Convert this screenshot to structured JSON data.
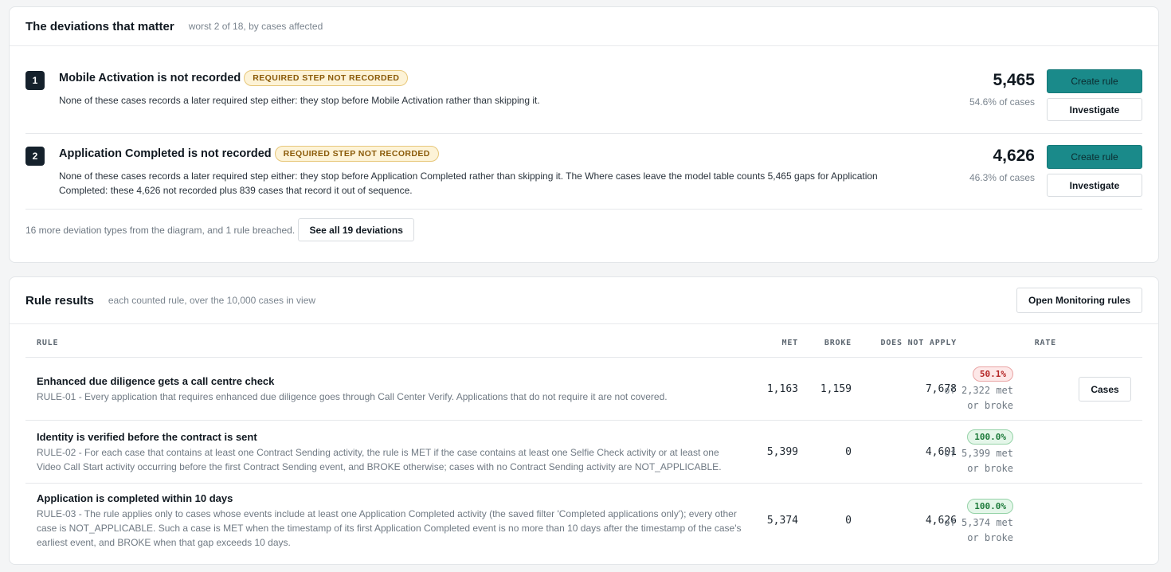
{
  "deviations": {
    "title": "The deviations that matter",
    "subtitle": "worst 2 of 18, by cases affected",
    "items": [
      {
        "rank": "1",
        "title": "Mobile Activation is not recorded",
        "badge": "REQUIRED STEP NOT RECORDED",
        "description": "None of these cases records a later required step either: they stop before Mobile Activation rather than skipping it.",
        "count": "5,465",
        "pct": "54.6% of cases",
        "create_label": "Create rule",
        "investigate_label": "Investigate"
      },
      {
        "rank": "2",
        "title": "Application Completed is not recorded",
        "badge": "REQUIRED STEP NOT RECORDED",
        "description": "None of these cases records a later required step either: they stop before Application Completed rather than skipping it. The Where cases leave the model table counts 5,465 gaps for Application Completed: these 4,626 not recorded plus 839 cases that record it out of sequence.",
        "count": "4,626",
        "pct": "46.3% of cases",
        "create_label": "Create rule",
        "investigate_label": "Investigate"
      }
    ],
    "footer_text": "16 more deviation types from the diagram, and 1 rule breached.",
    "see_all_label": "See all 19 deviations"
  },
  "rules": {
    "title": "Rule results",
    "subtitle": "each counted rule, over the 10,000 cases in view",
    "open_label": "Open Monitoring rules",
    "columns": {
      "rule": "RULE",
      "met": "MET",
      "broke": "BROKE",
      "dna": "DOES NOT APPLY",
      "rate": "RATE"
    },
    "rows": [
      {
        "name": "Enhanced due diligence gets a call centre check",
        "description": "RULE-01 - Every application that requires enhanced due diligence goes through Call Center Verify. Applications that do not require it are not covered.",
        "met": "1,163",
        "broke": "1,159",
        "dna": "7,678",
        "rate": "50.1%",
        "rate_note": "of 2,322 met or broke",
        "cases_label": "Cases"
      },
      {
        "name": "Identity is verified before the contract is sent",
        "description": "RULE-02 - For each case that contains at least one Contract Sending activity, the rule is MET if the case contains at least one Selfie Check activity or at least one Video Call Start activity occurring before the first Contract Sending event, and BROKE otherwise; cases with no Contract Sending activity are NOT_APPLICABLE.",
        "met": "5,399",
        "broke": "0",
        "dna": "4,601",
        "rate": "100.0%",
        "rate_note": "of 5,399 met or broke"
      },
      {
        "name": "Application is completed within 10 days",
        "description": "RULE-03 - The rule applies only to cases whose events include at least one Application Completed activity (the saved filter 'Completed applications only'); every other case is NOT_APPLICABLE. Such a case is MET when the timestamp of its first Application Completed event is no more than 10 days after the timestamp of the case's earliest event, and BROKE when that gap exceeds 10 days.",
        "met": "5,374",
        "broke": "0",
        "dna": "4,626",
        "rate": "100.0%",
        "rate_note": "of 5,374 met or broke"
      }
    ]
  }
}
